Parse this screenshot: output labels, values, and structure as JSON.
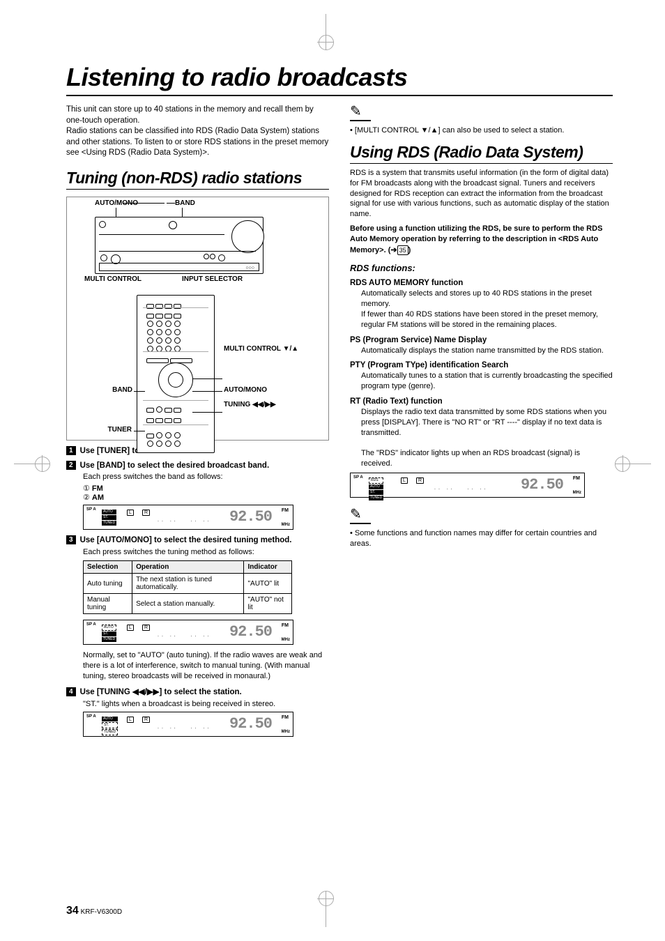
{
  "main_title": "Listening to radio broadcasts",
  "intro": "This unit can store up to 40 stations in the memory and recall them by one-touch operation.\nRadio stations can be classified into RDS (Radio Data System) stations and other stations. To listen to or store RDS stations in the preset memory see <Using RDS (Radio Data System)>.",
  "left": {
    "section_title": "Tuning (non-RDS) radio stations",
    "diag": {
      "auto_mono": "AUTO/MONO",
      "band_top": "BAND",
      "multi_control": "MULTI CONTROL",
      "input_selector": "INPUT SELECTOR",
      "multi_control_ud": "MULTI CONTROL ▼/▲",
      "band_side": "BAND",
      "auto_mono_side": "AUTO/MONO",
      "tuning": "TUNING ◀◀/▶▶",
      "tuner": "TUNER"
    },
    "step1": "Use [TUNER] to select the tuner.",
    "step2": {
      "title": "Use [BAND] to select the desired broadcast band.",
      "sub": "Each press switches the band as follows:",
      "opt1": "① FM",
      "opt2": "② AM"
    },
    "step3": {
      "title": "Use [AUTO/MONO] to select the desired tuning method.",
      "sub": "Each press switches the tuning method as follows:",
      "table": {
        "h1": "Selection",
        "h2": "Operation",
        "h3": "Indicator",
        "r1c1": "Auto tuning",
        "r1c2": "The next station is tuned automatically.",
        "r1c3": "\"AUTO\" lit",
        "r2c1": "Manual tuning",
        "r2c2": "Select a station manually.",
        "r2c3": "\"AUTO\" not lit"
      },
      "note": "Normally, set to \"AUTO\" (auto tuning). If the radio waves are weak and there is a lot of interference, switch to manual tuning. (With manual tuning, stereo broadcasts will be received in monaural.)"
    },
    "step4": {
      "title": "Use [TUNING ◀◀/▶▶] to select the station.",
      "sub": "\"ST.\" lights when a broadcast is being received in stereo."
    },
    "lcd": {
      "sp": "SP A",
      "auto": "AUTO",
      "st": "ST.",
      "tuned": "TUNED",
      "L": "L",
      "R": "R",
      "freq": "92.50",
      "fm": "FM",
      "mhz": "MHz"
    }
  },
  "right": {
    "note1": "[MULTI CONTROL ▼/▲] can also be used to select a station.",
    "section_title": "Using RDS (Radio Data System)",
    "intro": "RDS is a system that transmits useful information (in the form of digital data) for FM broadcasts along with the broadcast signal. Tuners and receivers designed for RDS reception can extract the information from the broadcast signal for use with various functions, such as automatic display of the station name.",
    "bold_block": "Before using a function utilizing the RDS, be sure to perform the RDS Auto Memory operation by referring to the description in <RDS Auto Memory>. (➔",
    "bold_block_page": "35",
    "bold_block_end": ")",
    "rds_funcs_title": "RDS functions:",
    "funcs": {
      "f1t": "RDS AUTO MEMORY function",
      "f1b": "Automatically selects and stores up to 40 RDS stations in the preset memory.\nIf fewer than 40 RDS stations have been stored in the preset memory, regular FM stations will be stored in the remaining places.",
      "f2t": "PS (Program Service) Name Display",
      "f2b": "Automatically displays the station name transmitted by the RDS station.",
      "f3t": "PTY (Program TYpe) identification Search",
      "f3b": "Automatically tunes to a station that is currently broadcasting the specified program type (genre).",
      "f4t": "RT (Radio Text) function",
      "f4b": "Displays the radio text data transmitted by some RDS stations when you press [DISPLAY]. There is \"NO RT\" or \"RT ----\" display if no text data is transmitted.",
      "indicator": "The \"RDS\" indicator lights up when an RDS broadcast (signal) is received."
    },
    "lcd_rds": "RDS",
    "note2": "Some functions and function names may differ for certain countries and areas."
  },
  "footer": {
    "page_num": "34",
    "model": "KRF-V6300D"
  }
}
